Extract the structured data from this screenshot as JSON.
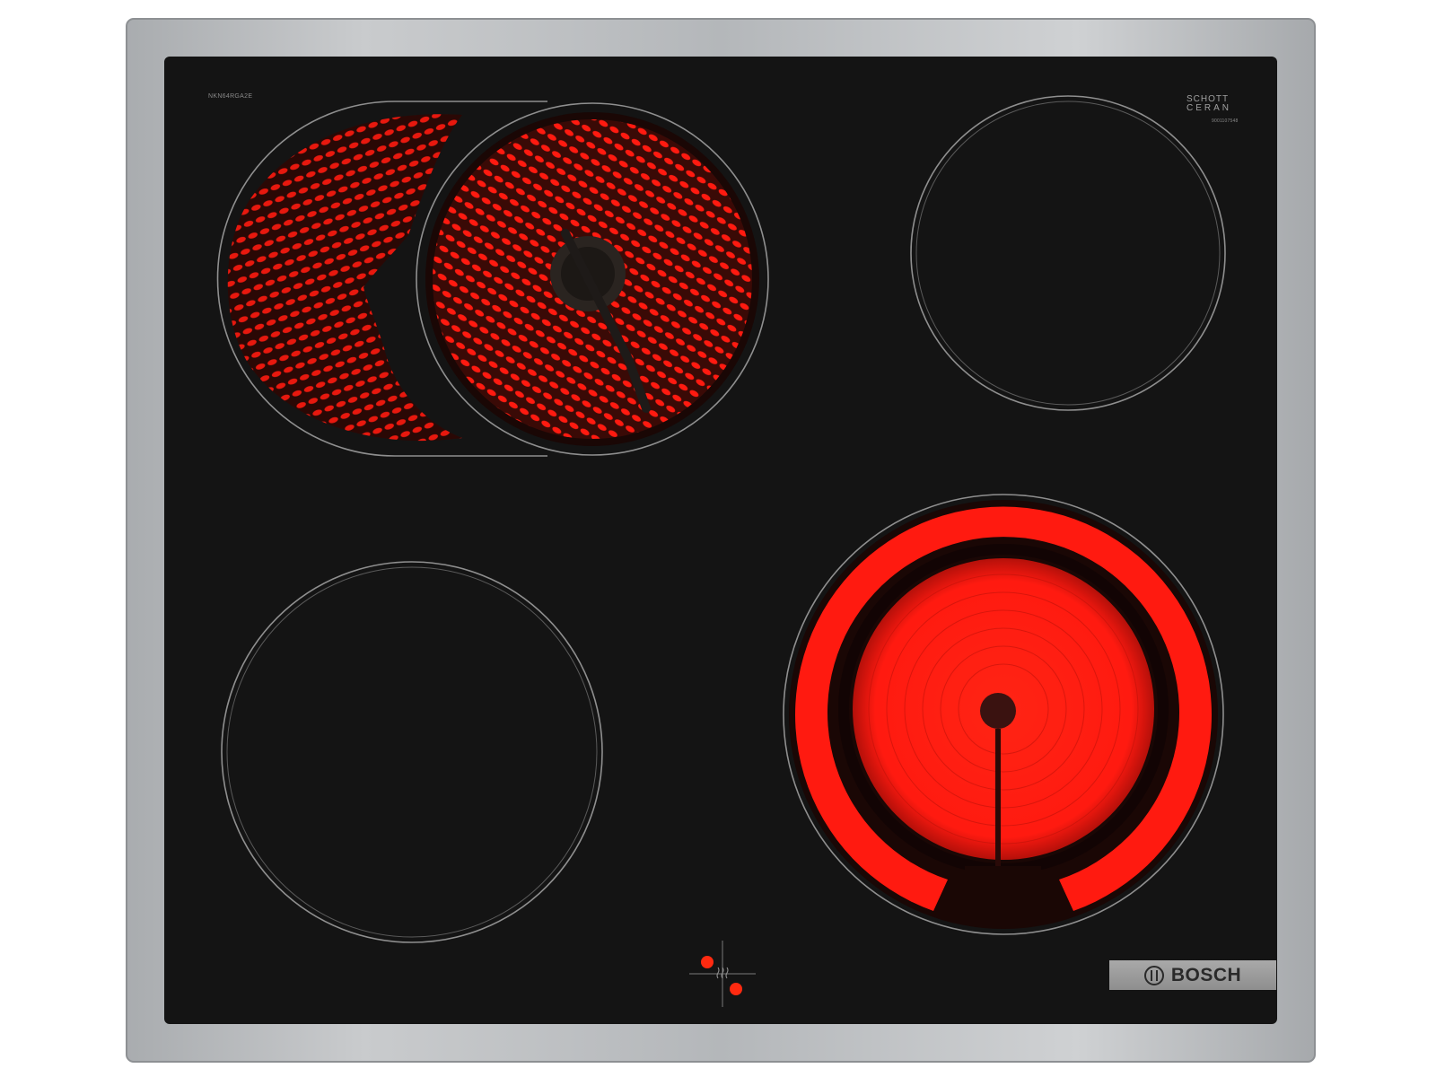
{
  "appliance": {
    "model_code": "NKN64RGA2E",
    "glass_brand_line1": "SCHOTT",
    "glass_brand_line2": "CERAN",
    "glass_serial": "9001107548",
    "brand": "BOSCH"
  },
  "colors": {
    "frame_steel": "#b9bcbf",
    "glass_black": "#141414",
    "zone_outline": "#8f8f8f",
    "heat_red": "#ff1a10",
    "indicator_red": "#ff2a10"
  },
  "zones": [
    {
      "id": "rear-left",
      "type": "dual-oval",
      "state": "heating"
    },
    {
      "id": "rear-right",
      "type": "single",
      "state": "off"
    },
    {
      "id": "front-left",
      "type": "single",
      "state": "off"
    },
    {
      "id": "front-right",
      "type": "dual-circle",
      "state": "heating"
    }
  ],
  "indicators": {
    "residual_heat_icon": "heat-waves-icon",
    "active_lights": 2
  }
}
